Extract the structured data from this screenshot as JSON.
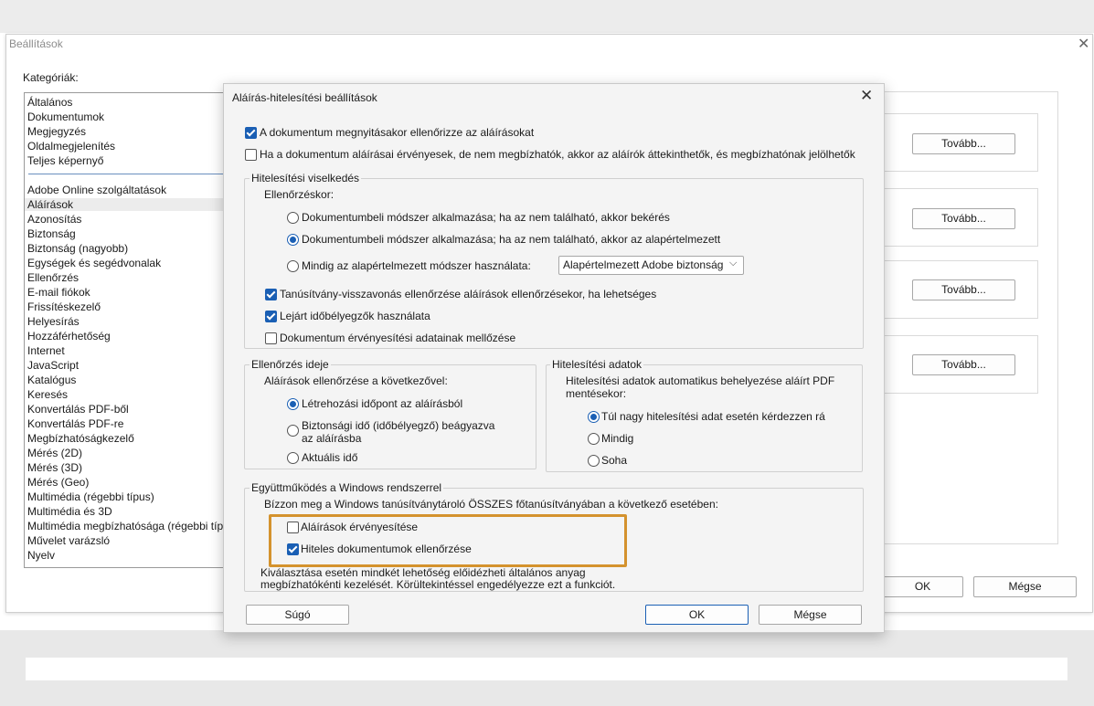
{
  "background": {
    "window_title": "Beállítások",
    "categories_label": "Kategóriák:",
    "categories_top": [
      "Általános",
      "Dokumentumok",
      "Megjegyzés",
      "Oldalmegjelenítés",
      "Teljes képernyő"
    ],
    "categories": [
      "Adobe Online szolgáltatások",
      "Aláírások",
      "Azonosítás",
      "Biztonság",
      "Biztonság (nagyobb)",
      "Egységek és segédvonalak",
      "Ellenőrzés",
      "E-mail fiókok",
      "Frissítéskezelő",
      "Helyesírás",
      "Hozzáférhetőség",
      "Internet",
      "JavaScript",
      "Katalógus",
      "Keresés",
      "Konvertálás PDF-ből",
      "Konvertálás PDF-re",
      "Megbízhatóságkezelő",
      "Mérés (2D)",
      "Mérés (3D)",
      "Mérés (Geo)",
      "Multimédia (régebbi típus)",
      "Multimédia és 3D",
      "Multimédia megbízhatósága (régebbi típus)",
      "Művelet varázsló",
      "Nyelv"
    ],
    "selected_category": "Aláírások",
    "more_button": "Tovább...",
    "ok_button": "OK",
    "cancel_button": "Mégse"
  },
  "dialog": {
    "title": "Aláírás-hitelesítési beállítások",
    "verify_on_open": "A dokumentum megnyitásakor ellenőrizze az aláírásokat",
    "verify_on_open_checked": true,
    "valid_untrusted": "Ha a dokumentum aláírásai érvényesek, de nem megbízhatók, akkor az aláírók áttekinthetők, és megbízhatónak jelölhetők",
    "valid_untrusted_checked": false,
    "behavior_group": "Hitelesítési viselkedés",
    "when_verifying": "Ellenőrzéskor:",
    "method_prompt": "Dokumentumbeli módszer alkalmazása; ha az nem található, akkor bekérés",
    "method_default": "Dokumentumbeli módszer alkalmazása; ha az nem található, akkor az alapértelmezett",
    "method_always": "Mindig az alapértelmezett módszer használata:",
    "method_select_value": "Alapértelmezett Adobe biztonság",
    "revocation": "Tanúsítvány-visszavonás ellenőrzése aláírások ellenőrzésekor, ha lehetséges",
    "revocation_checked": true,
    "expired_timestamps": "Lejárt időbélyegzők használata",
    "expired_timestamps_checked": true,
    "ignore_validation": "Dokumentum érvényesítési adatainak mellőzése",
    "ignore_validation_checked": false,
    "time_group": "Ellenőrzés ideje",
    "verify_using": "Aláírások ellenőrzése a következővel:",
    "time_creation": "Létrehozási időpont az aláírásból",
    "time_secure_1": "Biztonsági idő (időbélyegző) beágyazva",
    "time_secure_2": "az aláírásba",
    "time_current": "Aktuális idő",
    "validation_group": "Hitelesítési adatok",
    "validation_desc_1": "Hitelesítési adatok automatikus behelyezése aláírt PDF",
    "validation_desc_2": "mentésekor:",
    "validation_ask": "Túl nagy hitelesítési adat esetén kérdezzen rá",
    "validation_always": "Mindig",
    "validation_never": "Soha",
    "windows_group": "Együttműködés a Windows rendszerrel",
    "windows_trust": "Bízzon meg a Windows tanúsítványtároló ÖSSZES főtanúsítványában a következő esetében:",
    "validate_signatures": "Aláírások érvényesítése",
    "validate_signatures_checked": false,
    "certified_docs": "Hiteles dokumentumok ellenőrzése",
    "certified_docs_checked": true,
    "windows_note_1": "Kiválasztása esetén mindkét lehetőség előidézheti általános anyag",
    "windows_note_2": "megbízhatókénti kezelését. Körültekintéssel engedélyezze ezt a funkciót.",
    "help_button": "Súgó",
    "ok_button": "OK",
    "cancel_button": "Mégse"
  },
  "colors": {
    "accent": "#1a5fb4",
    "highlight": "#d4922d"
  },
  "icons": {
    "close": "close-icon",
    "dropdown": "chevron-down-icon"
  }
}
